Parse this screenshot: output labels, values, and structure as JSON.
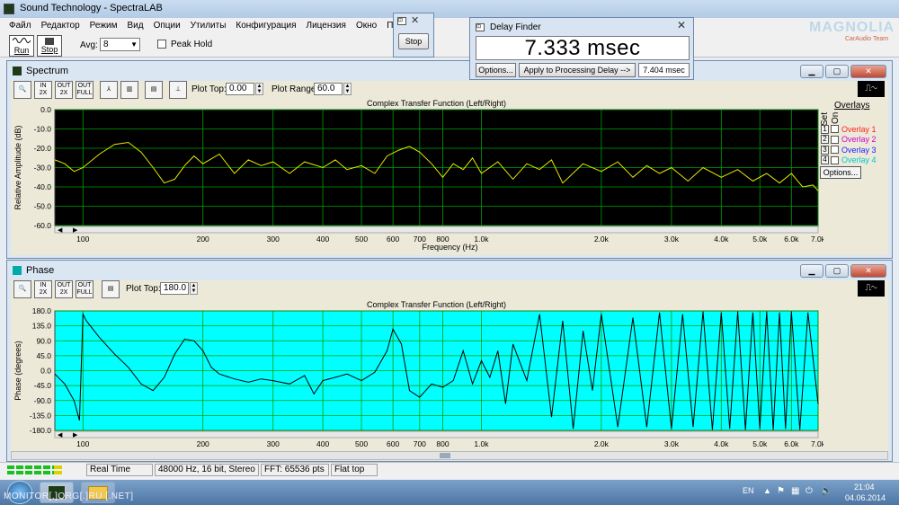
{
  "app": {
    "title": "Sound Technology - SpectraLAB",
    "menu": [
      "Файл",
      "Редактор",
      "Режим",
      "Вид",
      "Опции",
      "Утилиты",
      "Конфигурация",
      "Лицензия",
      "Окно",
      "Помощь"
    ],
    "run_label": "Run",
    "stop_label": "Stop",
    "avg_label": "Avg:",
    "avg_value": "8",
    "peak_hold_label": "Peak Hold"
  },
  "stop_dialog": {
    "button": "Stop"
  },
  "delay_finder": {
    "title": "Delay Finder",
    "value": "7.333 msec",
    "options_label": "Options...",
    "apply_label": "Apply to Processing Delay -->",
    "applied_value": "7.404 msec"
  },
  "watermark": {
    "brand": "MAGNOLIA",
    "sub": "CarAudio Team"
  },
  "spectrum": {
    "title": "Spectrum",
    "plot_top_label": "Plot Top:",
    "plot_top_value": "0.00",
    "plot_range_label": "Plot Range:",
    "plot_range_value": "60.0",
    "overlays_label": "Overlays",
    "set_label": "Set",
    "on_label": "On",
    "overlays": [
      {
        "num": "1",
        "label": "Overlay 1",
        "color": "#ff2020"
      },
      {
        "num": "2",
        "label": "Overlay 2",
        "color": "#d000d0"
      },
      {
        "num": "3",
        "label": "Overlay 3",
        "color": "#2020ff"
      },
      {
        "num": "4",
        "label": "Overlay 4",
        "color": "#00c8c8"
      }
    ],
    "options_label": "Options...",
    "icons": [
      "zoom-icon",
      "zoom-in-2x-icon",
      "zoom-out-2x-icon",
      "zoom-full-icon",
      "line-plot-icon",
      "bar-plot-icon",
      "settings-icon",
      "marker-icon"
    ]
  },
  "phase": {
    "title": "Phase",
    "plot_top_label": "Plot Top:",
    "plot_top_value": "180.0"
  },
  "chart_data": [
    {
      "type": "line",
      "title": "Complex Transfer Function (Left/Right)",
      "xlabel": "Frequency (Hz)",
      "ylabel": "Relative Amplitude (dB)",
      "xscale": "log",
      "xlim": [
        85,
        7000
      ],
      "ylim": [
        -60,
        0
      ],
      "xticks": [
        "100",
        "200",
        "300",
        "400",
        "500",
        "600",
        "700",
        "800",
        "1.0k",
        "2.0k",
        "3.0k",
        "4.0k",
        "5.0k",
        "6.0k",
        "7.0k"
      ],
      "yticks": [
        "0.0",
        "-10.0",
        "-20.0",
        "-30.0",
        "-40.0",
        "-50.0",
        "-60.0"
      ],
      "background": "#000000",
      "grid_color": "#00a000",
      "series": [
        {
          "color": "#e8e800",
          "x": [
            85,
            90,
            95,
            100,
            110,
            120,
            130,
            140,
            150,
            160,
            170,
            180,
            190,
            200,
            220,
            240,
            260,
            280,
            300,
            330,
            360,
            400,
            430,
            460,
            500,
            540,
            580,
            620,
            660,
            700,
            750,
            800,
            850,
            900,
            950,
            1000,
            1100,
            1200,
            1300,
            1400,
            1500,
            1600,
            1800,
            2000,
            2200,
            2400,
            2600,
            2800,
            3000,
            3300,
            3600,
            4000,
            4400,
            4800,
            5200,
            5600,
            6000,
            6400,
            6800,
            7000
          ],
          "y": [
            -26,
            -28,
            -32,
            -30,
            -23,
            -18,
            -17,
            -22,
            -30,
            -38,
            -36,
            -29,
            -24,
            -28,
            -23,
            -33,
            -26,
            -29,
            -27,
            -33,
            -27,
            -30,
            -26,
            -31,
            -29,
            -33,
            -24,
            -21,
            -19,
            -22,
            -28,
            -35,
            -28,
            -31,
            -25,
            -33,
            -27,
            -36,
            -28,
            -31,
            -26,
            -38,
            -28,
            -32,
            -27,
            -35,
            -29,
            -33,
            -30,
            -37,
            -30,
            -35,
            -31,
            -37,
            -33,
            -38,
            -33,
            -40,
            -39,
            -42
          ]
        }
      ]
    },
    {
      "type": "line",
      "title": "Complex Transfer Function (Left/Right)",
      "ylabel": "Phase (degrees)",
      "xscale": "log",
      "xlim": [
        85,
        7000
      ],
      "ylim": [
        -180,
        180
      ],
      "xticks": [
        "100",
        "200",
        "300",
        "400",
        "500",
        "600",
        "700",
        "800",
        "1.0k",
        "2.0k",
        "3.0k",
        "4.0k",
        "5.0k",
        "6.0k",
        "7.0k"
      ],
      "yticks": [
        "180.0",
        "135.0",
        "90.0",
        "45.0",
        "0.0",
        "-45.0",
        "-90.0",
        "-135.0",
        "-180.0"
      ],
      "background": "#00ffff",
      "grid_color": "#00a000",
      "series": [
        {
          "color": "#000000",
          "x": [
            85,
            90,
            95,
            98,
            100,
            102,
            110,
            120,
            130,
            140,
            150,
            160,
            170,
            180,
            190,
            200,
            210,
            220,
            240,
            260,
            280,
            300,
            330,
            360,
            380,
            400,
            430,
            460,
            500,
            540,
            580,
            600,
            630,
            660,
            700,
            750,
            800,
            850,
            900,
            950,
            1000,
            1050,
            1100,
            1150,
            1200,
            1300,
            1400,
            1500,
            1600,
            1700,
            1800,
            1900,
            2000,
            2200,
            2400,
            2600,
            2800,
            3000,
            3200,
            3400,
            3600,
            3800,
            4000,
            4200,
            4400,
            4600,
            4800,
            5000,
            5200,
            5400,
            5600,
            5800,
            6000,
            6300,
            6600,
            7000
          ],
          "y": [
            -10,
            -40,
            -90,
            -150,
            170,
            150,
            100,
            50,
            10,
            -40,
            -60,
            -20,
            50,
            95,
            90,
            60,
            10,
            -10,
            -25,
            -35,
            -25,
            -30,
            -40,
            -15,
            -70,
            -30,
            -20,
            -10,
            -30,
            -5,
            60,
            125,
            80,
            -60,
            -80,
            -40,
            -50,
            -30,
            60,
            -40,
            30,
            -20,
            60,
            -100,
            80,
            -30,
            170,
            -140,
            150,
            -175,
            120,
            -60,
            170,
            -170,
            160,
            -170,
            175,
            -175,
            170,
            -170,
            178,
            -178,
            175,
            -175,
            178,
            -178,
            175,
            -175,
            178,
            -178,
            175,
            -175,
            178,
            -178,
            175,
            -100
          ]
        }
      ]
    }
  ],
  "status": {
    "mode": "Real Time",
    "format": "48000 Hz, 16 bit, Stereo",
    "fft": "FFT: 65536 pts",
    "window": "Flat top"
  },
  "taskbar": {
    "lang": "EN",
    "time": "21:04",
    "date": "04.06.2014",
    "watermark": "MONITOR[.]ORG[.]RU [.NET]"
  }
}
